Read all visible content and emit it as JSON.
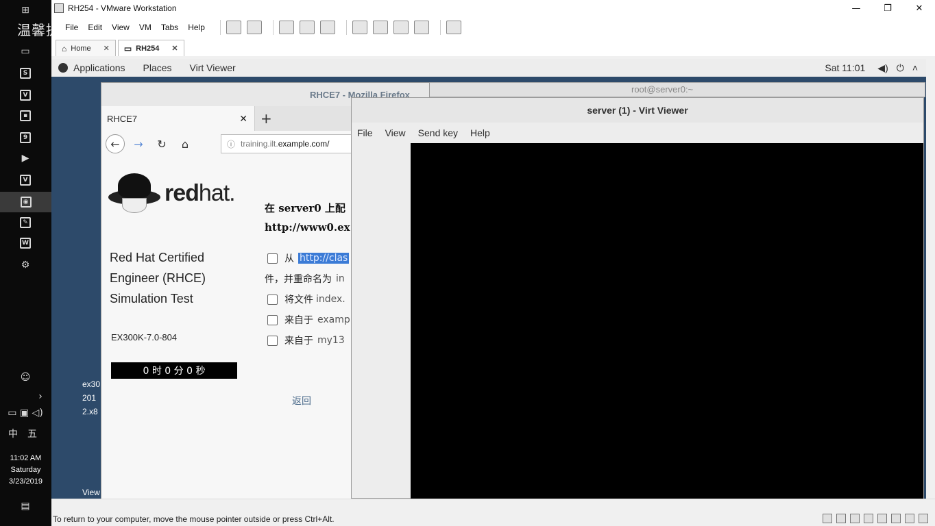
{
  "watermark": "温馨提示:",
  "taskbar": {
    "time": "11:02 AM",
    "day": "Saturday",
    "date": "3/23/2019",
    "ime_lang": "中",
    "ime_mode": "五"
  },
  "vmware": {
    "title": "RH254 - VMware Workstation",
    "menu": [
      "File",
      "Edit",
      "View",
      "VM",
      "Tabs",
      "Help"
    ],
    "tabs": [
      {
        "label": "Home"
      },
      {
        "label": "RH254"
      }
    ],
    "status": "To return to your computer, move the mouse pointer outside or press Ctrl+Alt."
  },
  "gnome": {
    "applications": "Applications",
    "places": "Places",
    "virt_viewer": "Virt Viewer",
    "clock": "Sat 11:01"
  },
  "desktop": {
    "labels": [
      "ex30",
      "201",
      "2.x8",
      "View"
    ]
  },
  "firefox": {
    "title": "RHCE7 - Mozilla Firefox",
    "tab_label": "RHCE7",
    "url_prefix": "training.ilt.",
    "url_domain": "example.com/",
    "logo_text_bold": "red",
    "logo_text": "hat.",
    "cert_lines": [
      "Red Hat Certified",
      "Engineer (RHCE)",
      "Simulation Test"
    ],
    "exam_code": "EX300K-7.0-804",
    "timer": "0 时 0 分 0 秒",
    "task_line1": "在 server0 上配",
    "task_line2": "http://www0.ex",
    "items": [
      {
        "prefix": "从",
        "text": "http://clas"
      },
      {
        "prefix": "件，并重命名为",
        "text": "in"
      },
      {
        "prefix": "将文件",
        "text": "index."
      },
      {
        "prefix": "来自于",
        "text": "examp"
      },
      {
        "prefix": "来自于",
        "text": "my13"
      }
    ],
    "back": "返回"
  },
  "terminal_title": "root@server0:~",
  "virt_viewer": {
    "title": "server (1) - Virt Viewer",
    "menu": [
      "File",
      "View",
      "Send key",
      "Help"
    ]
  }
}
